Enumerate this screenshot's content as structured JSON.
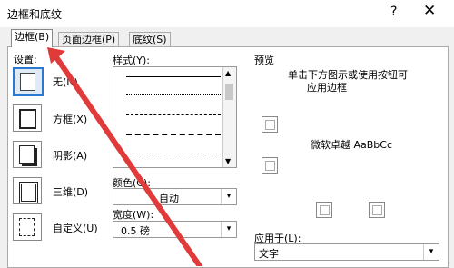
{
  "window": {
    "title": "边框和底纹",
    "help_icon": "?",
    "close_icon": "✕"
  },
  "tabs": [
    {
      "label": "边框(B)",
      "active": true
    },
    {
      "label": "页面边框(P)",
      "active": false
    },
    {
      "label": "底纹(S)",
      "active": false
    }
  ],
  "settings": {
    "heading": "设置:",
    "items": [
      {
        "label": "无(N)",
        "icon": "none-border-icon",
        "selected": true
      },
      {
        "label": "方框(X)",
        "icon": "box-border-icon",
        "selected": false
      },
      {
        "label": "阴影(A)",
        "icon": "shadow-border-icon",
        "selected": false
      },
      {
        "label": "三维(D)",
        "icon": "3d-border-icon",
        "selected": false
      },
      {
        "label": "自定义(U)",
        "icon": "custom-border-icon",
        "selected": false
      }
    ]
  },
  "style": {
    "heading": "样式(Y):"
  },
  "color": {
    "heading": "颜色(C):",
    "value": "自动"
  },
  "width": {
    "heading": "宽度(W):",
    "value": "0.5 磅"
  },
  "preview": {
    "heading": "预览",
    "instructions_line1": "单击下方图示或使用按钮可",
    "instructions_line2": "应用边框",
    "sample_text": "微软卓越  AaBbCc"
  },
  "apply_to": {
    "heading": "应用于(L):",
    "value": "文字"
  },
  "annotation": {
    "type": "red-arrow",
    "color": "#e03a3a",
    "points_to": "tab-border"
  }
}
